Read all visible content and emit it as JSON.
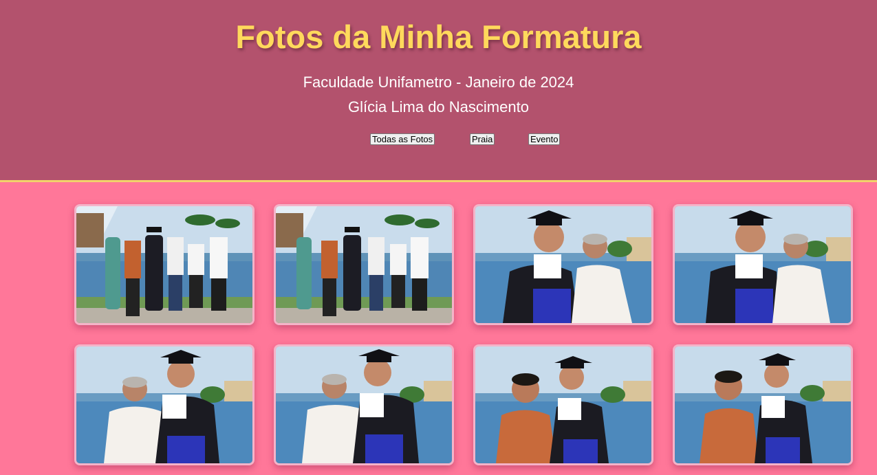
{
  "header": {
    "title": "Fotos da Minha Formatura",
    "subtitle": "Faculdade Unifametro - Janeiro de 2024",
    "author": "Glícia Lima do Nascimento"
  },
  "filters": [
    {
      "label": "Todas as Fotos"
    },
    {
      "label": "Praia"
    },
    {
      "label": "Evento"
    }
  ],
  "colors": {
    "header_bg": "#b3526d",
    "page_bg": "#ff7799",
    "title": "#ffd95c",
    "card_border": "#f5b3c8"
  },
  "gallery": [
    {
      "scene": "group-family-pool"
    },
    {
      "scene": "group-family-pool"
    },
    {
      "scene": "graduate-with-older-woman-right"
    },
    {
      "scene": "graduate-with-older-woman-right"
    },
    {
      "scene": "graduate-with-older-woman-left"
    },
    {
      "scene": "graduate-with-older-woman-left"
    },
    {
      "scene": "graduate-with-man-orange-shirt"
    },
    {
      "scene": "graduate-with-man-orange-shirt"
    }
  ]
}
